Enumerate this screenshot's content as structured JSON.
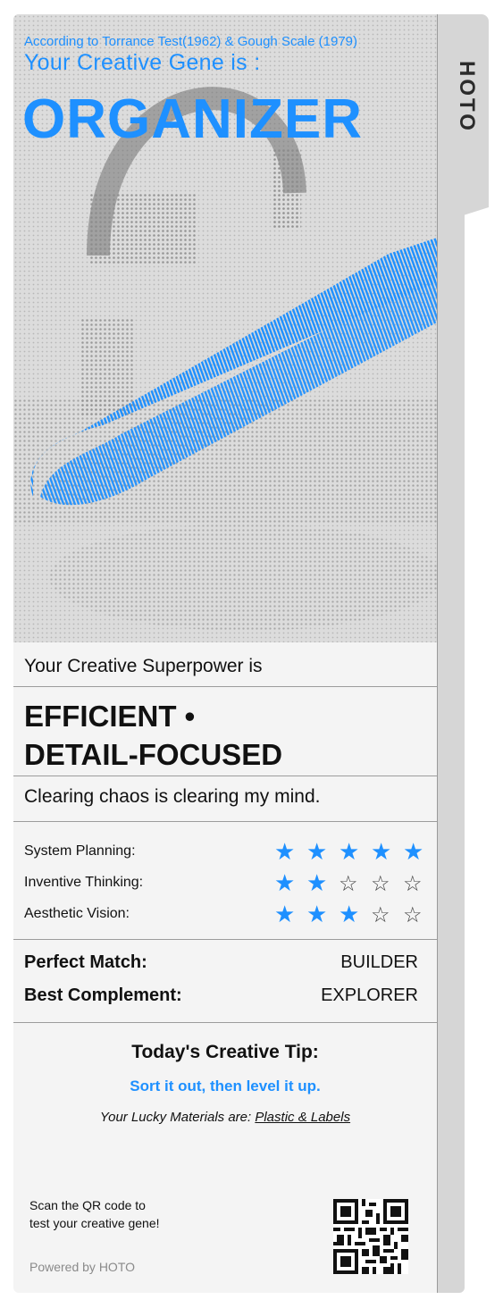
{
  "brand": "HOTO",
  "header": {
    "source": "According to Torrance Test(1962) & Gough Scale (1979)",
    "lead": "Your Creative Gene  is :",
    "gene": "ORGANIZER"
  },
  "superpower": {
    "intro": "Your Creative Superpower is",
    "title_line1": "EFFICIENT •",
    "title_line2": "DETAIL-FOCUSED",
    "quote": "Clearing chaos is clearing my mind."
  },
  "ratings": [
    {
      "label": "System Planning:",
      "stars": 5,
      "max": 5
    },
    {
      "label": "Inventive Thinking:",
      "stars": 2,
      "max": 5
    },
    {
      "label": "Aesthetic Vision:",
      "stars": 3,
      "max": 5
    }
  ],
  "matches": [
    {
      "label": "Perfect Match:",
      "value": "BUILDER"
    },
    {
      "label": "Best Complement:",
      "value": "EXPLORER"
    }
  ],
  "tip": {
    "heading": "Today's Creative Tip:",
    "text": "Sort it out, then level it up.",
    "lucky_prefix": "Your Lucky Materials are: ",
    "lucky_value": "Plastic & Labels"
  },
  "footer": {
    "scan_line1": "Scan the QR code to",
    "scan_line2": "test your creative gene!",
    "powered": "Powered by HOTO"
  },
  "colors": {
    "accent": "#1e90ff",
    "card": "#f4f4f4",
    "tab": "#d6d6d6"
  }
}
